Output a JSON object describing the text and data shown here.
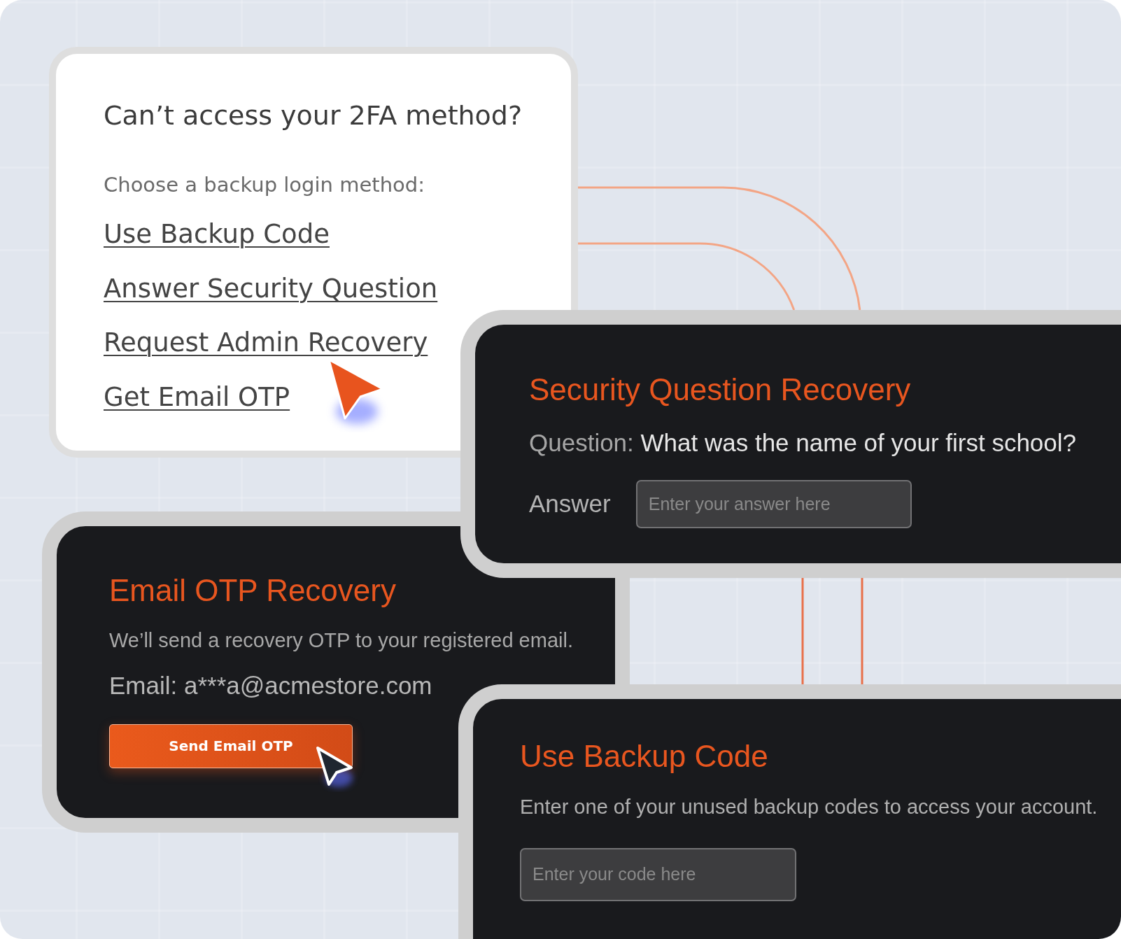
{
  "recovery_menu": {
    "title": "Can’t access your 2FA method?",
    "prompt": "Choose a backup login method:",
    "options": [
      "Use Backup Code",
      "Answer Security Question",
      "Request Admin Recovery",
      "Get Email OTP"
    ]
  },
  "security_question_card": {
    "title": "Security Question Recovery",
    "question_label": "Question:",
    "question": "What was the name of your first school?",
    "answer_label": "Answer",
    "answer_field": {
      "placeholder": "Enter your answer here"
    }
  },
  "email_otp_card": {
    "title": "Email OTP Recovery",
    "description": "We’ll send a recovery OTP to your registered email.",
    "email": "Email: a***a@acmestore.com",
    "button": "Send Email OTP"
  },
  "backup_code_card": {
    "title": "Use Backup Code",
    "description": "Enter one of your unused backup codes to access your account.",
    "code_field": {
      "placeholder": "Enter your code here"
    }
  }
}
